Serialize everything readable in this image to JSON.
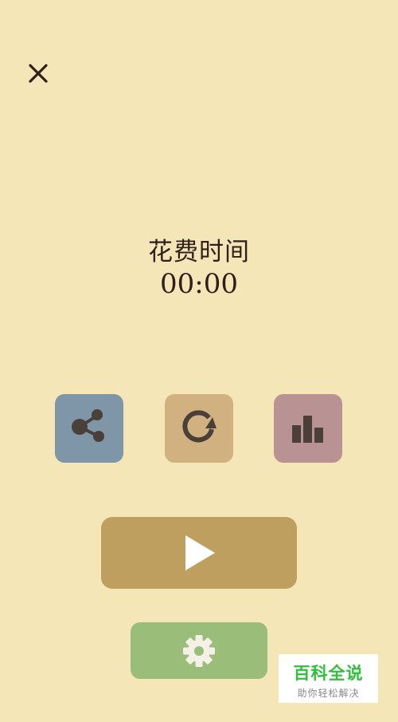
{
  "header": {
    "close_icon": "close-icon"
  },
  "result": {
    "title": "花费时间",
    "time": "00:00"
  },
  "actions": [
    {
      "name": "share",
      "icon": "share-icon",
      "color": "#7e96a8"
    },
    {
      "name": "restart",
      "icon": "restart-icon",
      "color": "#d2b181"
    },
    {
      "name": "stats",
      "icon": "bar-chart-icon",
      "color": "#b99393"
    }
  ],
  "play": {
    "icon": "play-icon",
    "color": "#bf9f5f"
  },
  "settings": {
    "icon": "gear-icon",
    "color": "#9abd7a"
  },
  "colors": {
    "background": "#f5e6b8",
    "text": "#2e1f1a",
    "icon_dark": "#4a3f39"
  },
  "watermark": {
    "main": "百科全说",
    "sub": "助你轻松解决"
  }
}
